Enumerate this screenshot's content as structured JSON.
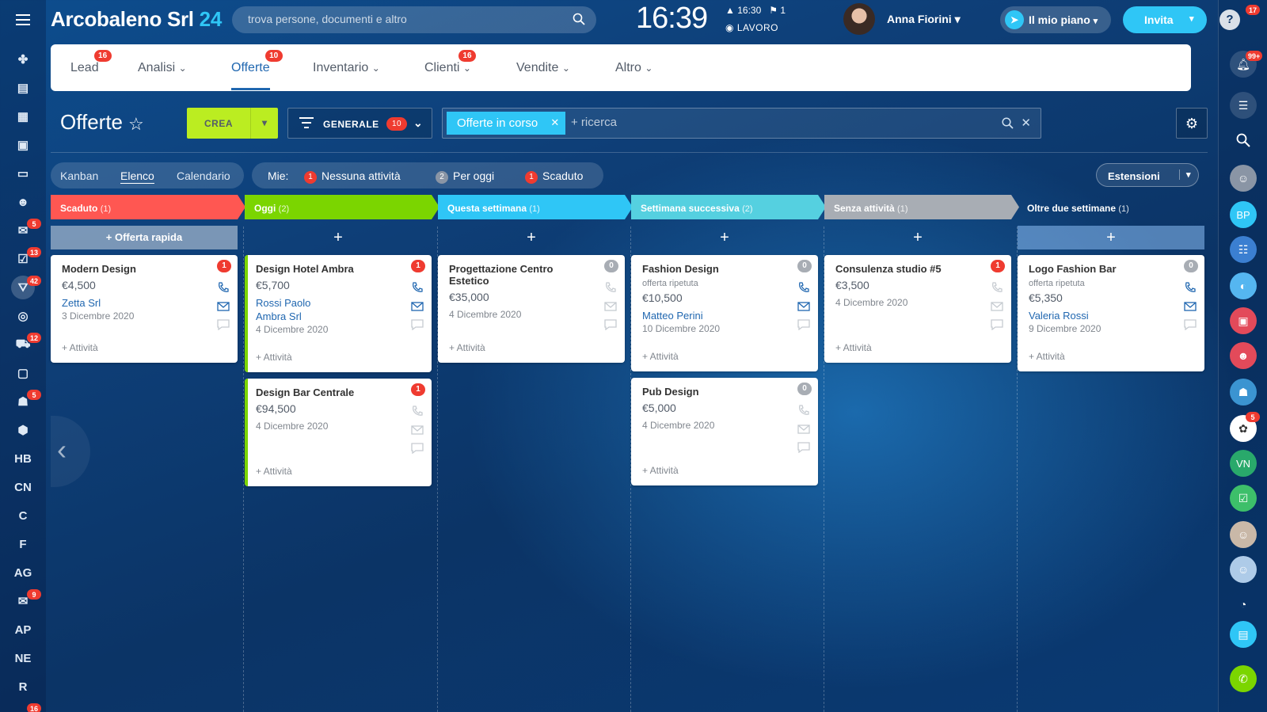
{
  "app": {
    "name": "Arcobaleno Srl",
    "suffix": "24"
  },
  "search": {
    "placeholder": "trova persone, documenti e altro"
  },
  "clock": {
    "time": "16:39",
    "sub_time": "16:30",
    "flags": "1",
    "status": "LAVORO"
  },
  "user": {
    "name": "Anna Fiorini"
  },
  "plan_label": "Il mio piano",
  "invite_label": "Invita",
  "help_badge": "17",
  "nav": {
    "tabs": [
      {
        "label": "Lead",
        "badge": "16"
      },
      {
        "label": "Analisi",
        "badge": ""
      },
      {
        "label": "Offerte",
        "badge": "10"
      },
      {
        "label": "Inventario",
        "badge": ""
      },
      {
        "label": "Clienti",
        "badge": "16"
      },
      {
        "label": "Vendite",
        "badge": ""
      },
      {
        "label": "Altro",
        "badge": ""
      }
    ]
  },
  "page": {
    "title": "Offerte"
  },
  "toolbar": {
    "create_label": "CREA",
    "filter_label": "GENERALE",
    "filter_count": "10",
    "active_filter": "Offerte in corso",
    "search_placeholder": "+ ricerca"
  },
  "views": [
    "Kanban",
    "Elenco",
    "Calendario"
  ],
  "mie": {
    "label": "Mie:",
    "items": [
      {
        "count": "1",
        "label": "Nessuna attività",
        "color": "#ef3b30"
      },
      {
        "count": "2",
        "label": "Per oggi",
        "color": "#8a95a5"
      },
      {
        "count": "1",
        "label": "Scaduto",
        "color": "#ef3b30"
      }
    ]
  },
  "extensions_label": "Estensioni",
  "quick_offer": "+ Offerta rapida",
  "left_sidebar": {
    "text_items": [
      "HB",
      "CN",
      "C",
      "F",
      "AG",
      "AP",
      "NE",
      "R"
    ],
    "badges": {
      "chat": "5",
      "tasks": "13",
      "crm": "42",
      "shop": "12",
      "robot": "5",
      "mail": "9",
      "bottom": "16"
    }
  },
  "right_sidebar": {
    "badges": {
      "bell": "99+",
      "group": "5"
    },
    "initials": [
      "BP",
      "VN"
    ]
  },
  "columns": [
    {
      "title": "Scaduto",
      "count": "(1)",
      "color": "#ff5752",
      "cards": [
        {
          "title": "Modern Design",
          "sub": "",
          "price": "€4,500",
          "links": [
            "Zetta Srl"
          ],
          "date": "3 Dicembre 2020",
          "badge": "1",
          "activity": "+ Attività"
        }
      ]
    },
    {
      "title": "Oggi",
      "count": "(2)",
      "color": "#7bd500",
      "cards": [
        {
          "title": "Design Hotel Ambra",
          "sub": "",
          "price": "€5,700",
          "links": [
            "Rossi Paolo",
            "Ambra Srl"
          ],
          "date": "4 Dicembre 2020",
          "badge": "1",
          "activity": "+ Attività"
        },
        {
          "title": "Design Bar Centrale",
          "sub": "",
          "price": "€94,500",
          "links": [],
          "date": "4 Dicembre 2020",
          "badge": "1",
          "activity": "+ Attività"
        }
      ]
    },
    {
      "title": "Questa settimana",
      "count": "(1)",
      "color": "#2fc6f6",
      "cards": [
        {
          "title": "Progettazione Centro Estetico",
          "sub": "",
          "price": "€35,000",
          "links": [],
          "date": "4 Dicembre 2020",
          "badge": "0",
          "activity": "+ Attività"
        }
      ]
    },
    {
      "title": "Settimana successiva",
      "count": "(2)",
      "color": "#55d0e0",
      "cards": [
        {
          "title": "Fashion Design",
          "sub": "offerta ripetuta",
          "price": "€10,500",
          "links": [
            "Matteo Perini"
          ],
          "date": "10 Dicembre 2020",
          "badge": "0",
          "activity": "+ Attività"
        },
        {
          "title": "Pub Design",
          "sub": "",
          "price": "€5,000",
          "links": [],
          "date": "4 Dicembre 2020",
          "badge": "0",
          "activity": "+ Attività"
        }
      ]
    },
    {
      "title": "Senza attività",
      "count": "(1)",
      "color": "#a8adb4",
      "cards": [
        {
          "title": "Consulenza studio #5",
          "sub": "",
          "price": "€3,500",
          "links": [],
          "date": "4 Dicembre 2020",
          "badge": "1",
          "activity": "+ Attività"
        }
      ]
    },
    {
      "title": "Oltre due settimane",
      "count": "(1)",
      "color": "#468ee5",
      "cards": [
        {
          "title": "Logo Fashion Bar",
          "sub": "offerta ripetuta",
          "price": "€5,350",
          "links": [
            "Valeria Rossi"
          ],
          "date": "9 Dicembre 2020",
          "badge": "0",
          "activity": "+ Attività"
        }
      ]
    }
  ]
}
